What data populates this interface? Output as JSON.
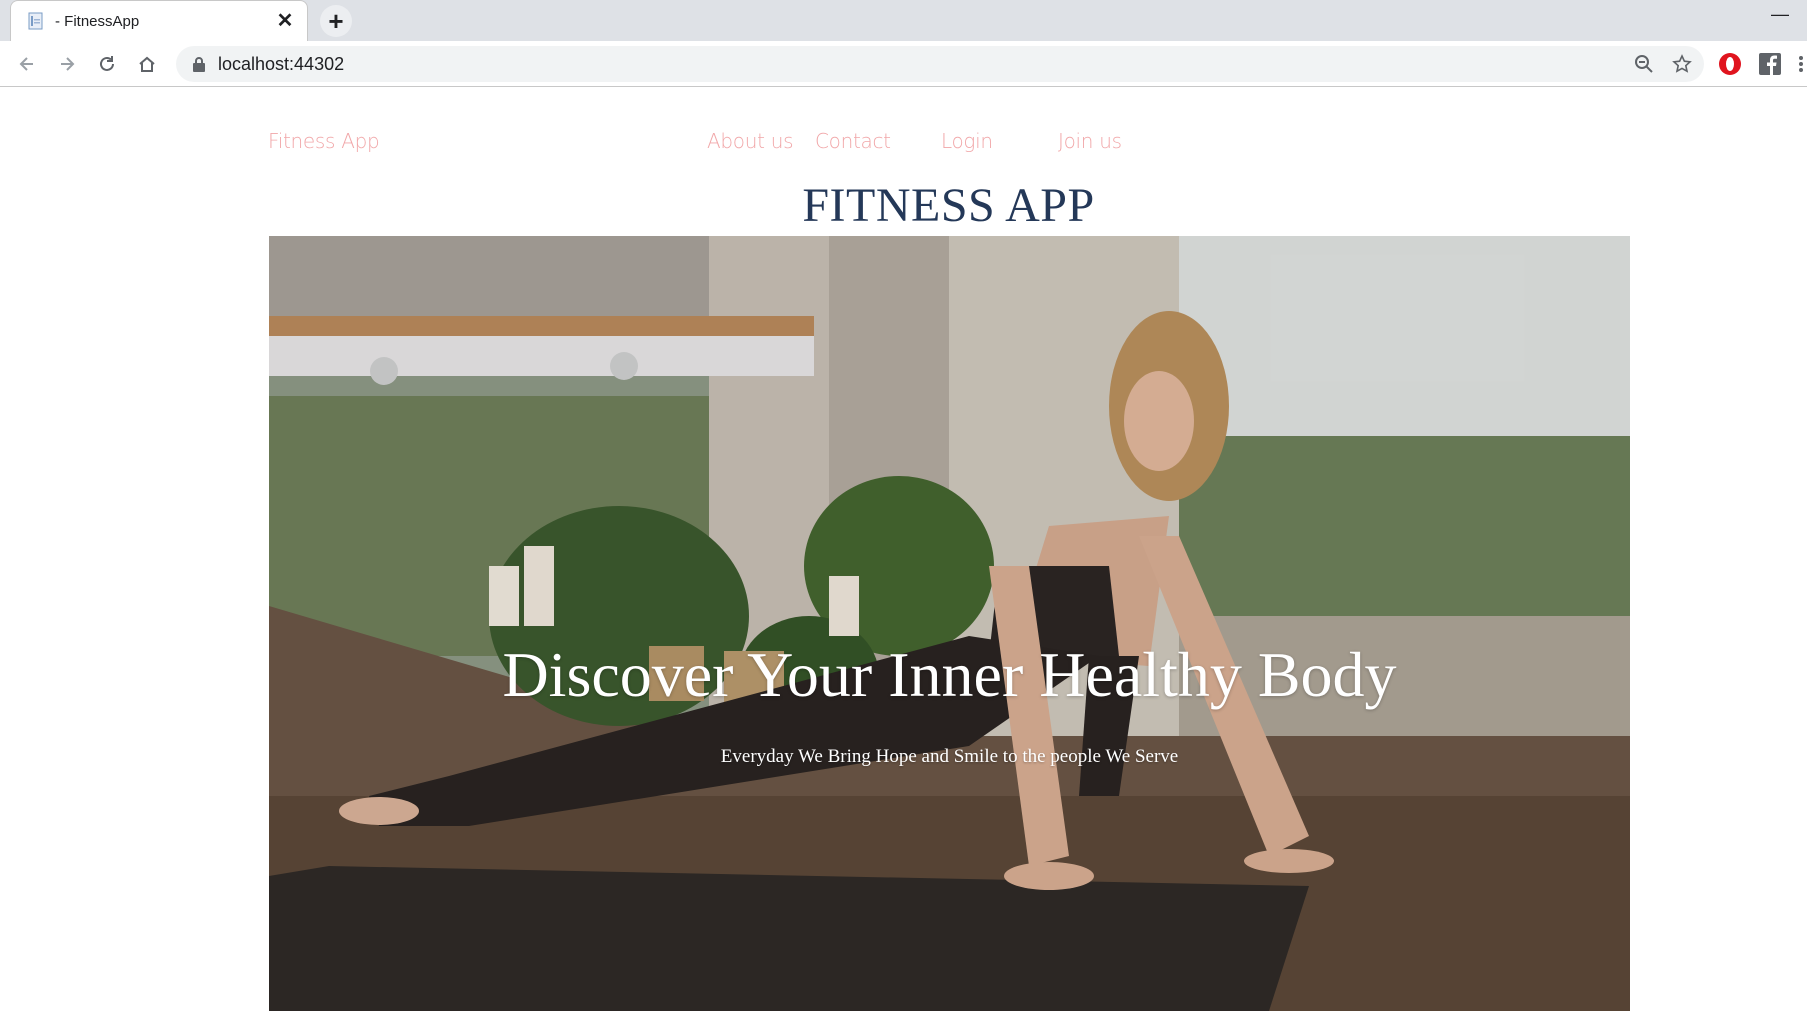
{
  "browser": {
    "tab_title": "- FitnessApp",
    "url": "localhost:44302",
    "icons": {
      "back": "arrow-left-icon",
      "forward": "arrow-right-icon",
      "reload": "reload-icon",
      "home": "home-icon",
      "lock": "lock-icon",
      "zoom": "zoom-icon",
      "bookmark": "star-icon",
      "opera_ext": "opera-icon",
      "facebook_ext": "facebook-icon"
    }
  },
  "nav": {
    "brand": "Fitness App",
    "links": [
      "About us",
      "Contact",
      "Login",
      "Join us"
    ],
    "color": "#f1a7a9"
  },
  "page": {
    "title": "FITNESS APP",
    "title_color": "#243858"
  },
  "hero": {
    "headline": "Discover Your Inner Healthy Body",
    "subtitle": "Everyday We Bring Hope and Smile to the people We Serve"
  }
}
